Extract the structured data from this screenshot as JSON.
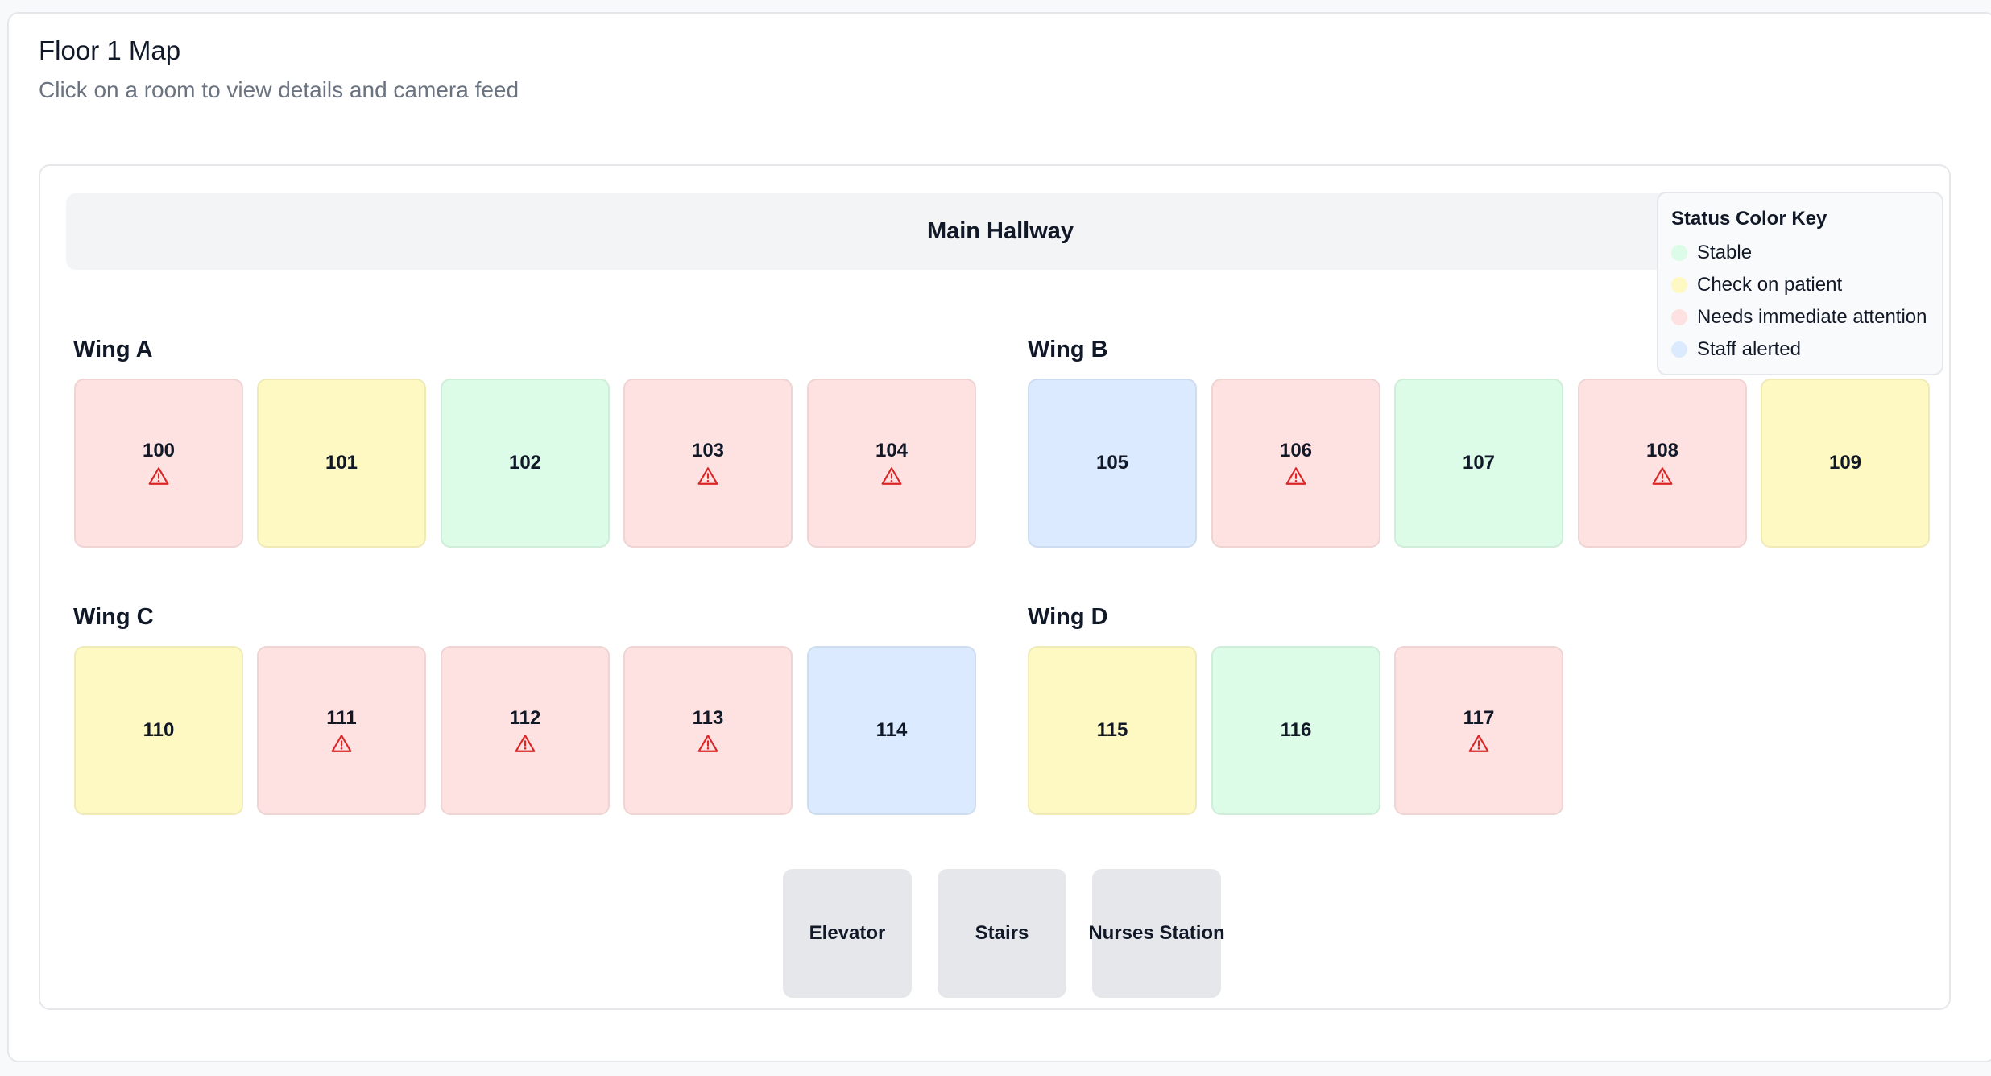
{
  "page": {
    "title": "Floor 1 Map",
    "subtitle": "Click on a room to view details and camera feed"
  },
  "hallway": {
    "label": "Main Hallway"
  },
  "legend": {
    "title": "Status Color Key",
    "items": [
      {
        "label": "Stable",
        "color": "#dcfce7"
      },
      {
        "label": "Check on patient",
        "color": "#fef9c3"
      },
      {
        "label": "Needs immediate attention",
        "color": "#fee2e2"
      },
      {
        "label": "Staff alerted",
        "color": "#dbeafe"
      }
    ]
  },
  "colors": {
    "stable": "#dcfce7",
    "check": "#fef9c3",
    "urgent": "#fee2e2",
    "alerted": "#dbeafe",
    "alert_icon": "#dc2626"
  },
  "wings": [
    {
      "label": "Wing A",
      "rooms": [
        {
          "number": "100",
          "status": "urgent",
          "alert": true
        },
        {
          "number": "101",
          "status": "check",
          "alert": false
        },
        {
          "number": "102",
          "status": "stable",
          "alert": false
        },
        {
          "number": "103",
          "status": "urgent",
          "alert": true
        },
        {
          "number": "104",
          "status": "urgent",
          "alert": true
        }
      ]
    },
    {
      "label": "Wing B",
      "rooms": [
        {
          "number": "105",
          "status": "alerted",
          "alert": false
        },
        {
          "number": "106",
          "status": "urgent",
          "alert": true
        },
        {
          "number": "107",
          "status": "stable",
          "alert": false
        },
        {
          "number": "108",
          "status": "urgent",
          "alert": true
        },
        {
          "number": "109",
          "status": "check",
          "alert": false
        }
      ]
    },
    {
      "label": "Wing C",
      "rooms": [
        {
          "number": "110",
          "status": "check",
          "alert": false
        },
        {
          "number": "111",
          "status": "urgent",
          "alert": true
        },
        {
          "number": "112",
          "status": "urgent",
          "alert": true
        },
        {
          "number": "113",
          "status": "urgent",
          "alert": true
        },
        {
          "number": "114",
          "status": "alerted",
          "alert": false
        }
      ]
    },
    {
      "label": "Wing D",
      "rooms": [
        {
          "number": "115",
          "status": "check",
          "alert": false
        },
        {
          "number": "116",
          "status": "stable",
          "alert": false
        },
        {
          "number": "117",
          "status": "urgent",
          "alert": true
        }
      ]
    }
  ],
  "facilities": [
    {
      "label": "Elevator"
    },
    {
      "label": "Stairs"
    },
    {
      "label": "Nurses Station"
    }
  ],
  "icons": {
    "alert": "warning-triangle-icon"
  }
}
